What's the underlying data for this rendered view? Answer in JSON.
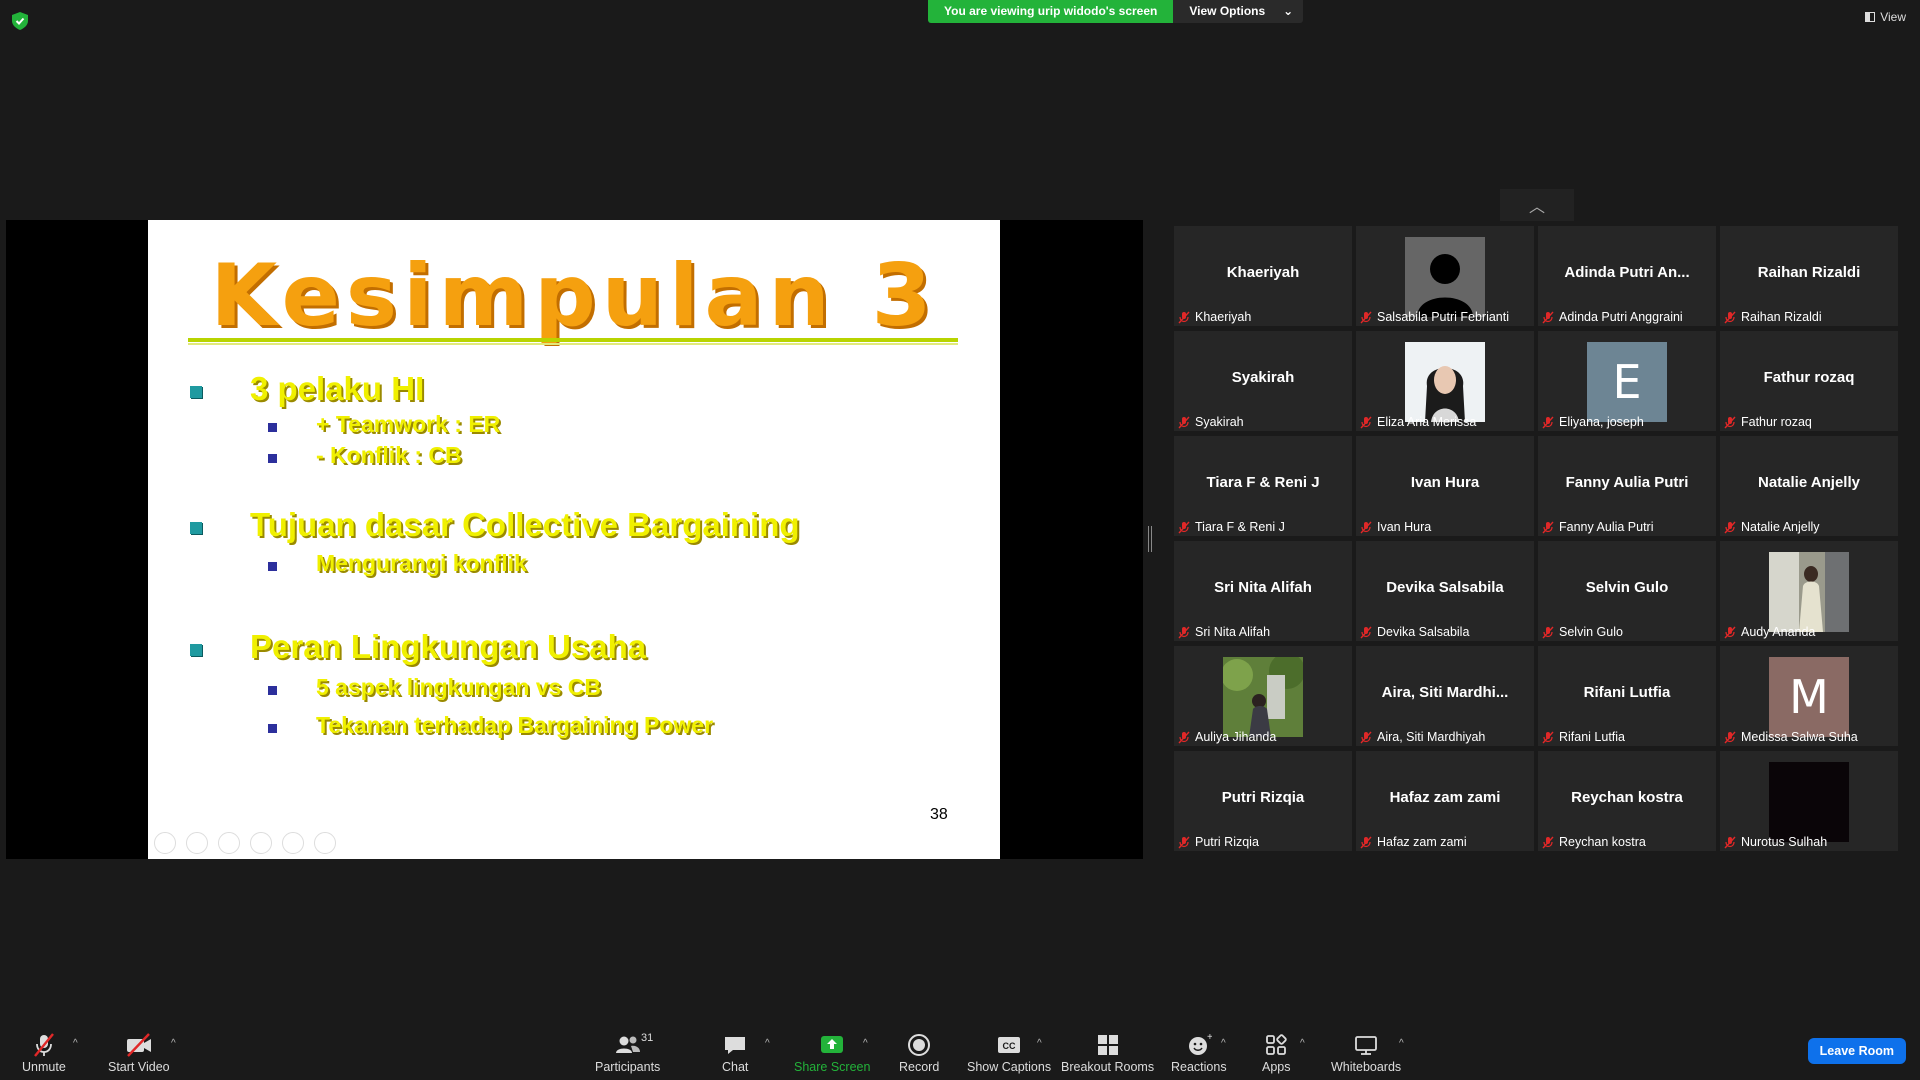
{
  "banner": {
    "viewing": "You are viewing urip widodo's screen",
    "options": "View Options"
  },
  "view_button": "View",
  "slide": {
    "title": "Kesimpulan 3",
    "bullets": [
      {
        "text": "3 pelaku HI",
        "subs": [
          "+ Teamwork : ER",
          "-  Konflik : CB"
        ]
      },
      {
        "text": "Tujuan dasar Collective Bargaining",
        "subs": [
          "Mengurangi konflik"
        ]
      },
      {
        "text": "Peran Lingkungan Usaha",
        "subs": [
          "5 aspek lingkungan vs CB",
          "Tekanan  terhadap Bargaining Power"
        ]
      }
    ],
    "page_number": "38"
  },
  "participants": [
    {
      "big": "Khaeriyah",
      "name": "Khaeriyah"
    },
    {
      "big": "",
      "name": "Salsabila Putri Febrianti",
      "pic": "silhouette"
    },
    {
      "big": "Adinda  Putri  An...",
      "name": "Adinda Putri Anggraini"
    },
    {
      "big": "Raihan Rizaldi",
      "name": "Raihan Rizaldi"
    },
    {
      "big": "Syakirah",
      "name": "Syakirah"
    },
    {
      "big": "",
      "name": "Eliza Aria Merissa",
      "pic": "photo-woman"
    },
    {
      "big": "",
      "name": "Eliyana, joseph",
      "pic": "letter",
      "letter": "E",
      "color": "#6d8594"
    },
    {
      "big": "Fathur rozaq",
      "name": "Fathur rozaq"
    },
    {
      "big": "Tiara F & Reni J",
      "name": "Tiara F & Reni J"
    },
    {
      "big": "Ivan Hura",
      "name": "Ivan Hura"
    },
    {
      "big": "Fanny Aulia Putri",
      "name": "Fanny Aulia Putri"
    },
    {
      "big": "Natalie Anjelly",
      "name": "Natalie Anjelly"
    },
    {
      "big": "Sri Nita Alifah",
      "name": "Sri Nita Alifah"
    },
    {
      "big": "Devika Salsabila",
      "name": "Devika Salsabila"
    },
    {
      "big": "Selvin Gulo",
      "name": "Selvin Gulo"
    },
    {
      "big": "",
      "name": "Audy Ananda",
      "pic": "photo-room"
    },
    {
      "big": "",
      "name": "Auliya Jihanda",
      "pic": "photo-garden"
    },
    {
      "big": "Aira,  Siti  Mardhi...",
      "name": "Aira, Siti Mardhiyah"
    },
    {
      "big": "Rifani Lutfia",
      "name": "Rifani Lutfia"
    },
    {
      "big": "",
      "name": "Medissa Salwa Suha",
      "pic": "letter",
      "letter": "M",
      "color": "#8a6a64"
    },
    {
      "big": "Putri Rizqia",
      "name": "Putri Rizqia"
    },
    {
      "big": "Hafaz zam zami",
      "name": "Hafaz zam zami"
    },
    {
      "big": "Reychan kostra",
      "name": "Reychan kostra"
    },
    {
      "big": "",
      "name": "Nurotus Sulhah",
      "pic": "dark"
    }
  ],
  "toolbar": {
    "unmute": "Unmute",
    "start_video": "Start Video",
    "participants": "Participants",
    "participant_count": "31",
    "chat": "Chat",
    "share_screen": "Share Screen",
    "record": "Record",
    "captions": "Show Captions",
    "breakout": "Breakout Rooms",
    "reactions": "Reactions",
    "apps": "Apps",
    "whiteboards": "Whiteboards",
    "leave": "Leave Room"
  },
  "colors": {
    "share_green": "#23b33a",
    "leave_blue": "#0e71eb",
    "muted_red": "#e02828"
  }
}
